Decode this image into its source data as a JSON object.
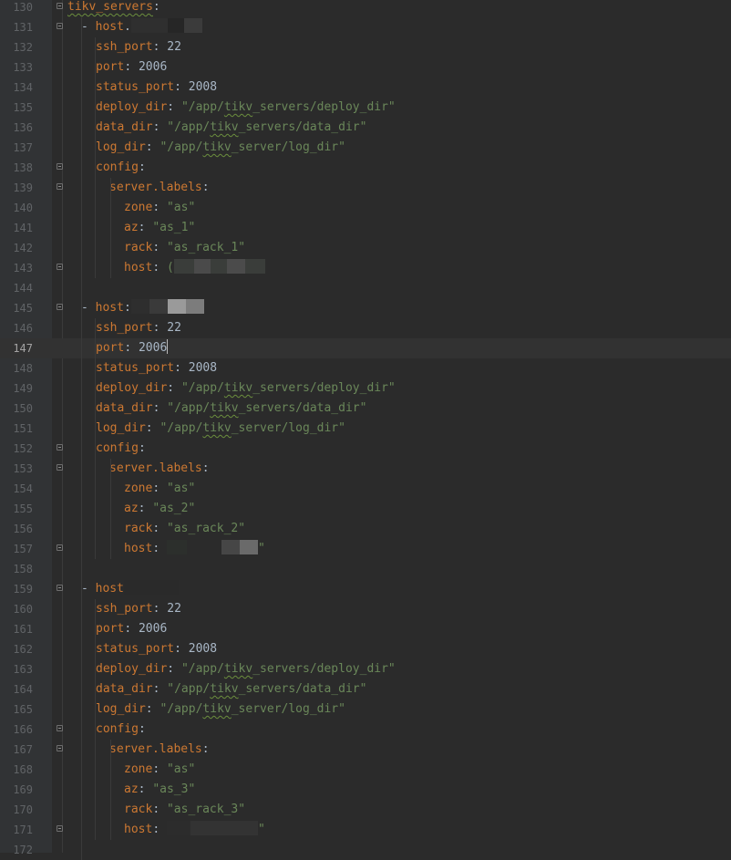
{
  "editor": {
    "current_line": 147,
    "lines": [
      {
        "num": "130",
        "key": "tikv_servers",
        "colon": ":",
        "squig": true,
        "fold": true
      },
      {
        "num": "131",
        "dash": true,
        "key": "host",
        "colon": ".",
        "redact": [
          [
            "#2f2f2f",
            40
          ],
          [
            "#262626",
            18
          ],
          [
            "#3b3b3b",
            20
          ]
        ],
        "fold": true
      },
      {
        "num": "132",
        "indent": 1,
        "key": "ssh_port",
        "colon": ": ",
        "num_val": "22"
      },
      {
        "num": "133",
        "indent": 1,
        "key": "port",
        "colon": ": ",
        "num_val": "2006"
      },
      {
        "num": "134",
        "indent": 1,
        "key": "status_port",
        "colon": ": ",
        "num_val": "2008"
      },
      {
        "num": "135",
        "indent": 1,
        "key": "deploy_dir",
        "colon": ": ",
        "str_pre": "\"/app/",
        "str_squig": "tikv",
        "str_post": "_servers/deploy_dir\""
      },
      {
        "num": "136",
        "indent": 1,
        "key": "data_dir",
        "colon": ": ",
        "str_pre": "\"/app/",
        "str_squig": "tikv",
        "str_post": "_servers/data_dir\""
      },
      {
        "num": "137",
        "indent": 1,
        "key": "log_dir",
        "colon": ": ",
        "str_pre": "\"/app/",
        "str_squig": "tikv",
        "str_post": "_server/log_dir\""
      },
      {
        "num": "138",
        "indent": 1,
        "key": "config",
        "colon": ":",
        "fold": true
      },
      {
        "num": "139",
        "indent": 2,
        "key": "server.labels",
        "colon": ":",
        "fold": true
      },
      {
        "num": "140",
        "indent": 3,
        "key": "zone",
        "colon": ": ",
        "str_pre": "\"as\""
      },
      {
        "num": "141",
        "indent": 3,
        "key": "az",
        "colon": ": ",
        "str_pre": "\"as_1\""
      },
      {
        "num": "142",
        "indent": 3,
        "key": "rack",
        "colon": ": ",
        "str_pre": "\"as_rack_1\""
      },
      {
        "num": "143",
        "indent": 3,
        "key": "host",
        "colon": ": ",
        "str_pre": "(",
        "redact": [
          [
            "#3a3d3a",
            22
          ],
          [
            "#4a4a4a",
            18
          ],
          [
            "#3a3d3a",
            18
          ],
          [
            "#4b4b4b",
            20
          ],
          [
            "#3a3d3a",
            22
          ]
        ],
        "fold": true
      },
      {
        "num": "144"
      },
      {
        "num": "145",
        "dash": true,
        "key": "host",
        "colon": ":",
        "redact": [
          [
            "#2e2e2e",
            20
          ],
          [
            "#3a3a3a",
            20
          ],
          [
            "#9a9a9a",
            20
          ],
          [
            "#7c7c7c",
            20
          ]
        ],
        "fold": true
      },
      {
        "num": "146",
        "indent": 1,
        "key": "ssh_port",
        "colon": ": ",
        "num_val": "22"
      },
      {
        "num": "147",
        "indent": 1,
        "key": "port",
        "colon": ": ",
        "num_val": "2006",
        "cursor": true
      },
      {
        "num": "148",
        "indent": 1,
        "key": "status_port",
        "colon": ": ",
        "num_val": "2008"
      },
      {
        "num": "149",
        "indent": 1,
        "key": "deploy_dir",
        "colon": ": ",
        "str_pre": "\"/app/",
        "str_squig": "tikv",
        "str_post": "_servers/deploy_dir\""
      },
      {
        "num": "150",
        "indent": 1,
        "key": "data_dir",
        "colon": ": ",
        "str_pre": "\"/app/",
        "str_squig": "tikv",
        "str_post": "_servers/data_dir\""
      },
      {
        "num": "151",
        "indent": 1,
        "key": "log_dir",
        "colon": ": ",
        "str_pre": "\"/app/",
        "str_squig": "tikv",
        "str_post": "_server/log_dir\""
      },
      {
        "num": "152",
        "indent": 1,
        "key": "config",
        "colon": ":",
        "fold": true
      },
      {
        "num": "153",
        "indent": 2,
        "key": "server.labels",
        "colon": ":",
        "fold": true
      },
      {
        "num": "154",
        "indent": 3,
        "key": "zone",
        "colon": ": ",
        "str_pre": "\"as\""
      },
      {
        "num": "155",
        "indent": 3,
        "key": "az",
        "colon": ": ",
        "str_pre": "\"as_2\""
      },
      {
        "num": "156",
        "indent": 3,
        "key": "rack",
        "colon": ": ",
        "str_pre": "\"as_rack_2\""
      },
      {
        "num": "157",
        "indent": 3,
        "key": "host",
        "colon": ": ",
        "redact": [
          [
            "#2c2f2c",
            22
          ],
          [
            "#2b2b2b",
            38
          ],
          [
            "#464646",
            20
          ],
          [
            "#6a6a6a",
            20
          ]
        ],
        "str_post": "\"",
        "fold": true
      },
      {
        "num": "158"
      },
      {
        "num": "159",
        "dash": true,
        "key": "host",
        "colon": "",
        "redact": [
          [
            "#2a2a2a",
            60
          ]
        ],
        "fold": true
      },
      {
        "num": "160",
        "indent": 1,
        "key": "ssh_port",
        "colon": ": ",
        "num_val": "22"
      },
      {
        "num": "161",
        "indent": 1,
        "key": "port",
        "colon": ": ",
        "num_val": "2006"
      },
      {
        "num": "162",
        "indent": 1,
        "key": "status_port",
        "colon": ": ",
        "num_val": "2008"
      },
      {
        "num": "163",
        "indent": 1,
        "key": "deploy_dir",
        "colon": ": ",
        "str_pre": "\"/app/",
        "str_squig": "tikv",
        "str_post": "_servers/deploy_dir\""
      },
      {
        "num": "164",
        "indent": 1,
        "key": "data_dir",
        "colon": ": ",
        "str_pre": "\"/app/",
        "str_squig": "tikv",
        "str_post": "_servers/data_dir\""
      },
      {
        "num": "165",
        "indent": 1,
        "key": "log_dir",
        "colon": ": ",
        "str_pre": "\"/app/",
        "str_squig": "tikv",
        "str_post": "_server/log_dir\""
      },
      {
        "num": "166",
        "indent": 1,
        "key": "config",
        "colon": ":",
        "fold": true
      },
      {
        "num": "167",
        "indent": 2,
        "key": "server.labels",
        "colon": ":",
        "fold": true
      },
      {
        "num": "168",
        "indent": 3,
        "key": "zone",
        "colon": ": ",
        "str_pre": "\"as\""
      },
      {
        "num": "169",
        "indent": 3,
        "key": "az",
        "colon": ": ",
        "str_pre": "\"as_3\""
      },
      {
        "num": "170",
        "indent": 3,
        "key": "rack",
        "colon": ": ",
        "str_pre": "\"as_rack_3\""
      },
      {
        "num": "171",
        "indent": 3,
        "key": "host",
        "colon": ": ",
        "redact": [
          [
            "#2c2c2c",
            26
          ],
          [
            "#333333",
            74
          ]
        ],
        "str_post": "\"",
        "fold": true
      },
      {
        "num": "172"
      }
    ]
  },
  "colors": {
    "background": "#2b2b2b",
    "gutter": "#313335",
    "key": "#cc7832",
    "string": "#6a8759",
    "number": "#a9b7c6",
    "line_number": "#606366"
  }
}
